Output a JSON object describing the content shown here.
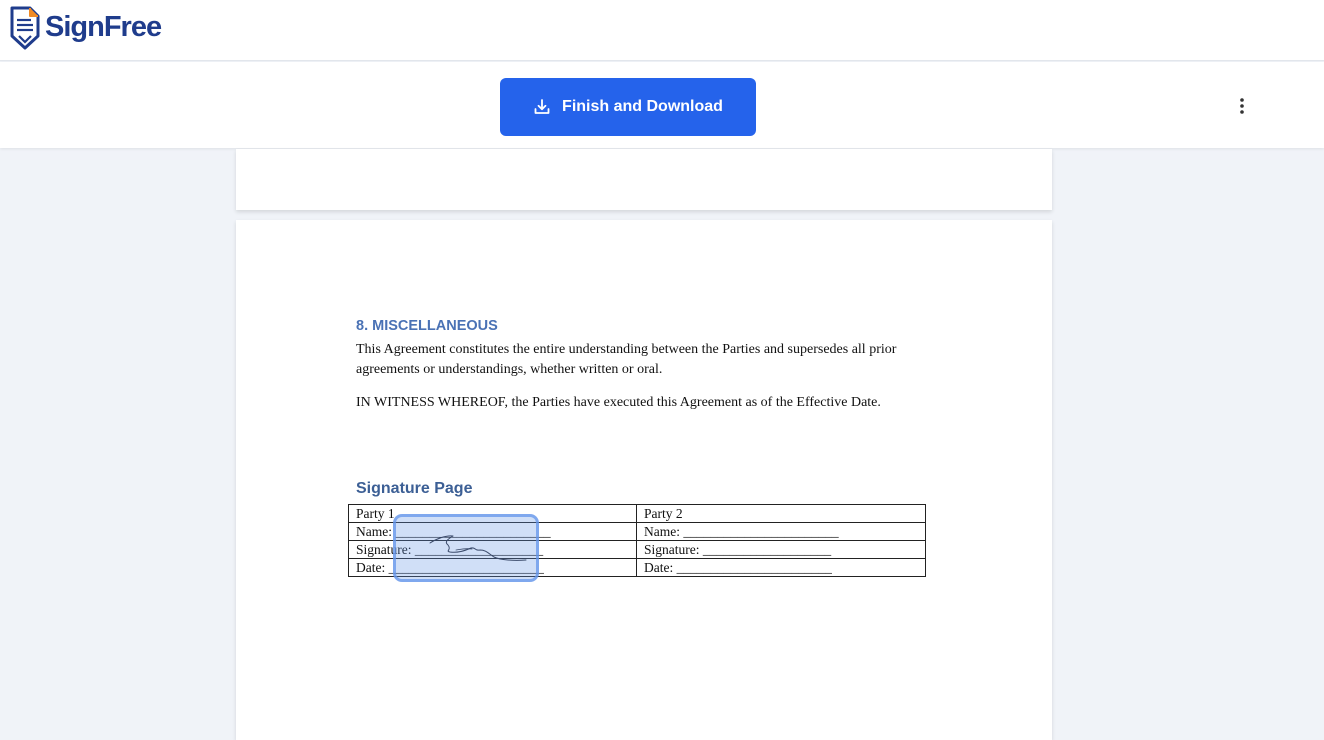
{
  "app": {
    "logo_text": "SignFree",
    "brand_color": "#1f3c8c",
    "accent_color": "#f08a24"
  },
  "toolbar": {
    "finish_label": "Finish and Download",
    "finish_icon": "download-icon",
    "finish_color": "#2563eb",
    "more_icon": "more-vertical-icon"
  },
  "document": {
    "section_heading": "8. MISCELLANEOUS",
    "paragraph1": "This Agreement constitutes the entire understanding between the Parties and supersedes all prior agreements or understandings, whether written or oral.",
    "paragraph2": "IN WITNESS WHEREOF, the Parties have executed this Agreement as of the Effective Date.",
    "signature_heading": "Signature Page",
    "table": {
      "rows": [
        [
          "Party 1",
          "Party 2"
        ],
        [
          "Name: _______________________",
          "Name: _______________________"
        ],
        [
          "Signature: ___________________",
          "Signature: ___________________"
        ],
        [
          "Date: _______________________",
          "Date: _______________________"
        ]
      ]
    }
  },
  "signature_field": {
    "icon": "signature-scribble-icon",
    "highlight_color": "#6496e6"
  }
}
